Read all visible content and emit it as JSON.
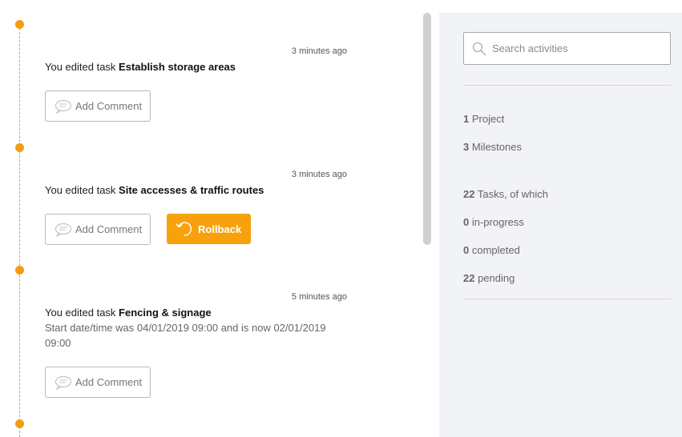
{
  "activities": [
    {
      "time": "3 minutes ago",
      "prefix": "You edited task ",
      "task": "Establish storage areas",
      "detail": "",
      "comment_label": "Add Comment",
      "rollback_label": ""
    },
    {
      "time": "3 minutes ago",
      "prefix": "You edited task ",
      "task": "Site accesses & traffic routes",
      "detail": "",
      "comment_label": "Add Comment",
      "rollback_label": "Rollback"
    },
    {
      "time": "5 minutes ago",
      "prefix": "You edited task ",
      "task": "Fencing & signage",
      "detail": "Start date/time was 04/01/2019 09:00 and is now 02/01/2019 09:00",
      "comment_label": "Add Comment",
      "rollback_label": ""
    }
  ],
  "sidebar": {
    "search_placeholder": "Search activities",
    "stats": {
      "project": {
        "count": "1",
        "label": " Project"
      },
      "milestones": {
        "count": "3",
        "label": " Milestones"
      },
      "tasks": {
        "count": "22",
        "label": " Tasks, of which"
      },
      "in_progress": {
        "count": "0",
        "label": " in-progress"
      },
      "completed": {
        "count": "0",
        "label": " completed"
      },
      "pending": {
        "count": "22",
        "label": " pending"
      }
    }
  },
  "colors": {
    "accent": "#f7a10d",
    "timeline": "#f39c12",
    "panel_bg": "#f2f3f7"
  },
  "icons": {
    "comment": "speech-bubble-icon",
    "rollback": "undo-arrow-icon",
    "search": "search-icon"
  }
}
